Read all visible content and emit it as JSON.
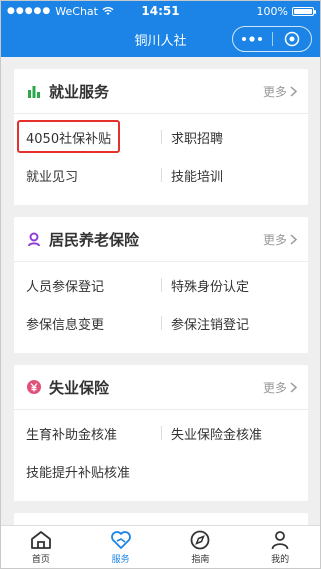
{
  "status_bar": {
    "carrier": "WeChat",
    "time": "14:51",
    "battery": "100%",
    "battery_level": 1.0
  },
  "nav": {
    "title": "铜川人社"
  },
  "colors": {
    "primary": "#1c84e6",
    "highlight": "#e4312b",
    "job_icon": "#2aa84a",
    "pension_icon": "#8f3fd6",
    "unemployment_icon": "#e0527a"
  },
  "sections": [
    {
      "title": "就业服务",
      "more": "更多",
      "icon": "bar-chart-icon",
      "items": [
        "4050社保补贴",
        "求职招聘",
        "就业见习",
        "技能培训"
      ]
    },
    {
      "title": "居民养老保险",
      "more": "更多",
      "icon": "person-icon",
      "items": [
        "人员参保登记",
        "特殊身份认定",
        "参保信息变更",
        "参保注销登记"
      ]
    },
    {
      "title": "失业保险",
      "more": "更多",
      "icon": "yen-coin-icon",
      "items": [
        "生育补助金核准",
        "失业保险金核准",
        "技能提升补贴核准"
      ]
    }
  ],
  "tabbar": {
    "tabs": [
      {
        "label": "首页",
        "icon": "home-icon",
        "active": false
      },
      {
        "label": "服务",
        "icon": "heart-hand-icon",
        "active": true
      },
      {
        "label": "指南",
        "icon": "compass-icon",
        "active": false
      },
      {
        "label": "我的",
        "icon": "user-icon",
        "active": false
      }
    ]
  }
}
